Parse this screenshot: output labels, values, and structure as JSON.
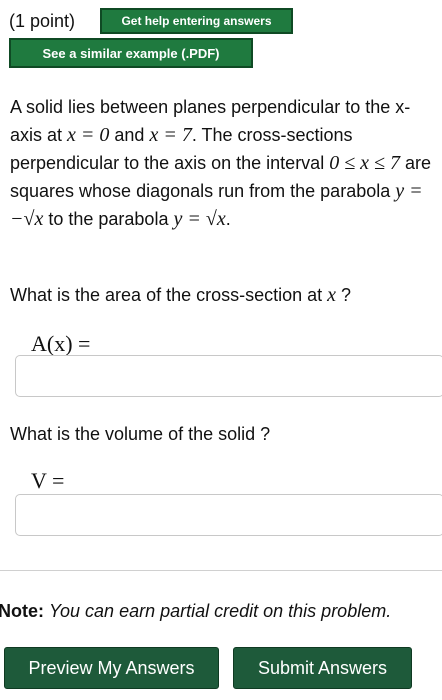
{
  "header": {
    "points": "(1 point)",
    "help_button": "Get help entering answers",
    "example_button": "See a similar example (.PDF)"
  },
  "problem": {
    "t1": "A solid lies between planes perpendicular to the x-axis at ",
    "m1": "x = 0",
    "t2": " and ",
    "m2": "x = 7",
    "t3": ". The cross-sections perpendicular to the axis on the interval ",
    "m3": "0 ≤ x ≤ 7",
    "t4": " are squares whose diagonals run from the parabola ",
    "m4": "y = −√x",
    "t5": " to the parabola ",
    "m5": "y = √x",
    "t6": "."
  },
  "question1": {
    "text_before": "What is the area of the cross-section at ",
    "var": "x",
    "text_after": " ?",
    "label": "A(x) =",
    "value": ""
  },
  "question2": {
    "text": "What is the volume of the solid ?",
    "label": "V =",
    "value": ""
  },
  "note": {
    "label": "Note:",
    "text": "You can earn partial credit on this problem."
  },
  "buttons": {
    "preview": "Preview My Answers",
    "submit": "Submit Answers"
  },
  "colors": {
    "help_button_bg": "#1f7a3f",
    "action_button_bg": "#1e5a3a"
  }
}
